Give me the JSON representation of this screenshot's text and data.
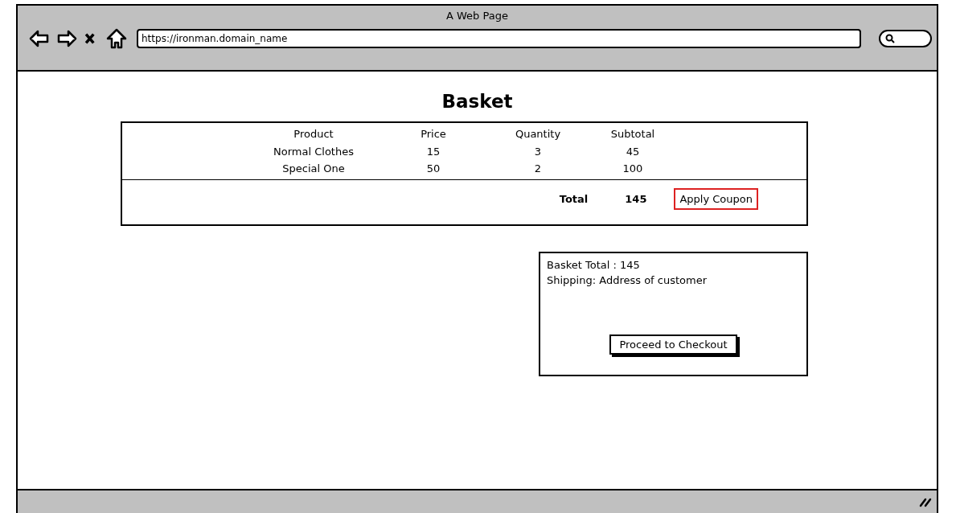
{
  "window": {
    "title": "A Web Page",
    "url": "https://ironman.domain_name"
  },
  "page": {
    "heading": "Basket"
  },
  "table": {
    "columns": [
      "Product",
      "Price",
      "Quantity",
      "Subtotal"
    ],
    "rows": [
      [
        "Normal Clothes",
        "15",
        "3",
        "45"
      ],
      [
        "Special One",
        "50",
        "2",
        "100"
      ]
    ],
    "total_label": "Total",
    "total_value": "145",
    "coupon_button": "Apply Coupon"
  },
  "summary": {
    "lines": [
      "Basket Total : 145",
      "Shipping: Address of customer"
    ],
    "checkout_button": "Proceed to Checkout"
  }
}
